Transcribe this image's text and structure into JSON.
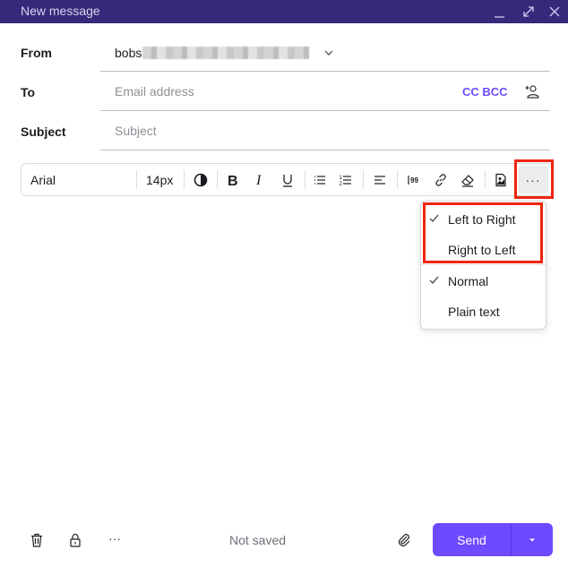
{
  "window": {
    "title": "New message",
    "controls": [
      "minimize-icon",
      "maximize-icon",
      "close-icon"
    ]
  },
  "fields": {
    "from": {
      "label": "From",
      "value_visible": "bobs",
      "value_obscured": true
    },
    "to": {
      "label": "To",
      "placeholder": "Email address",
      "cc_bcc": "CC BCC",
      "add_contact_icon": "add-contact-icon"
    },
    "subject": {
      "label": "Subject",
      "placeholder": "Subject"
    }
  },
  "toolbar": {
    "font": "Arial",
    "size": "14px",
    "buttons": [
      "contrast-icon",
      "bold-icon",
      "italic-icon",
      "underline-icon",
      "bullet-list-icon",
      "numbered-list-icon",
      "align-left-icon",
      "blockquote-icon",
      "link-icon",
      "eraser-icon",
      "image-icon",
      "more-icon"
    ],
    "more_label": "···"
  },
  "more_menu": {
    "items": [
      {
        "label": "Left to Right",
        "checked": true
      },
      {
        "label": "Right to Left",
        "checked": false
      },
      {
        "label": "Normal",
        "checked": true
      },
      {
        "label": "Plain text",
        "checked": false
      }
    ]
  },
  "footer": {
    "status": "Not saved",
    "send_label": "Send",
    "more_label": "···"
  },
  "colors": {
    "titlebar": "#372879",
    "accent": "#6d4aff",
    "highlight": "#f0250f"
  }
}
